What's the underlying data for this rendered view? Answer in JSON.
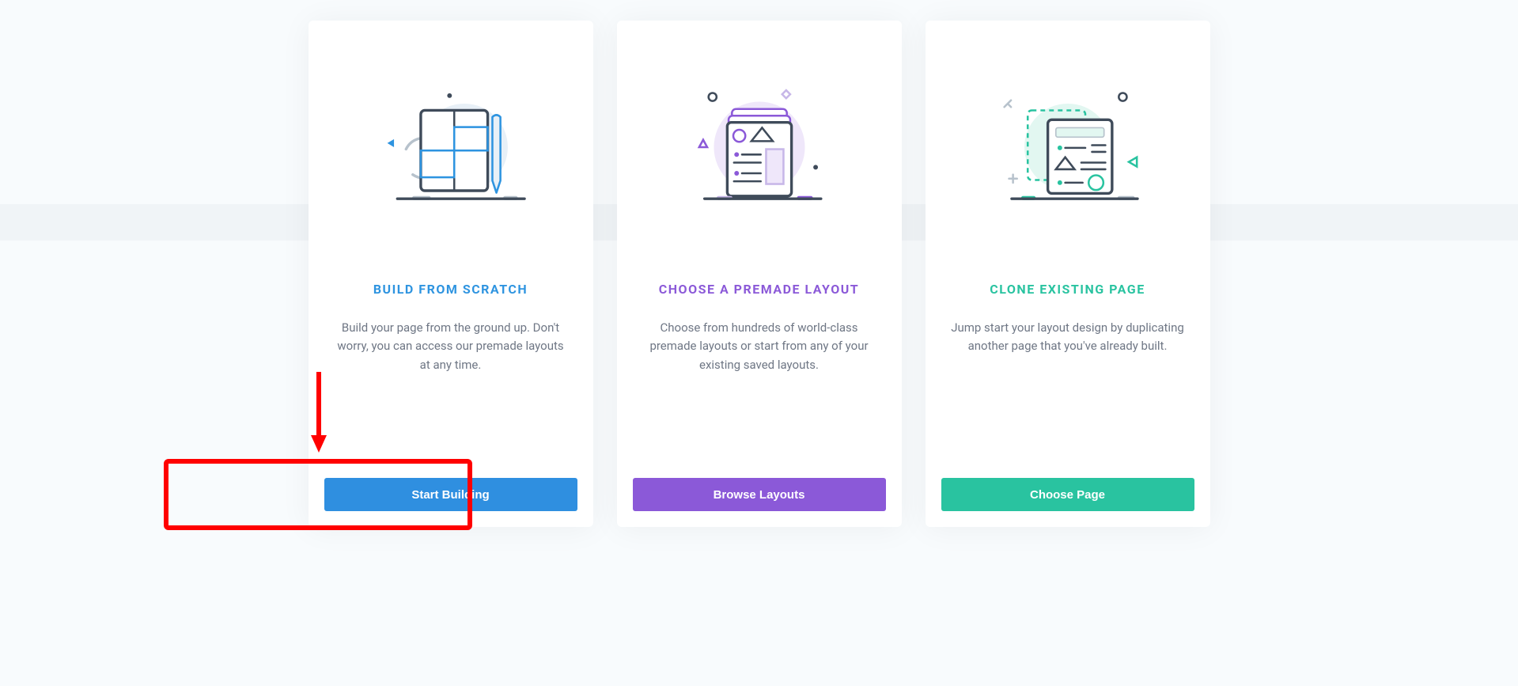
{
  "cards": [
    {
      "title": "BUILD FROM SCRATCH",
      "description": "Build your page from the ground up. Don't worry, you can access our premade layouts at any time.",
      "button": "Start Building"
    },
    {
      "title": "CHOOSE A PREMADE LAYOUT",
      "description": "Choose from hundreds of world-class premade layouts or start from any of your existing saved layouts.",
      "button": "Browse Layouts"
    },
    {
      "title": "CLONE EXISTING PAGE",
      "description": "Jump start your layout design by duplicating another page that you've already built.",
      "button": "Choose Page"
    }
  ],
  "colors": {
    "blue": "#2e94e0",
    "purple": "#8b59d8",
    "teal": "#29c3a0"
  }
}
